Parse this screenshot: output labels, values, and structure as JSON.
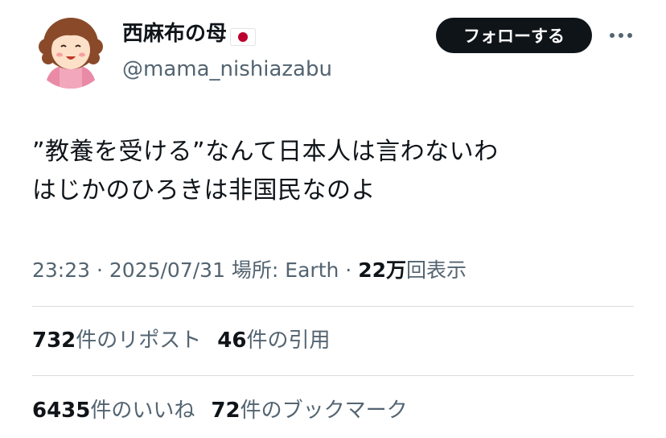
{
  "user": {
    "display_name": "西麻布の母",
    "flag_icon": "japan-flag-icon",
    "handle": "@mama_nishiazabu",
    "avatar_icon": "mother-illustration-avatar"
  },
  "follow_label": "フォローする",
  "more_icon": "more-horizontal-icon",
  "tweet": {
    "line1": "”教養を受ける”なんて日本人は言わないわ",
    "line2": "はじかのひろきは非国民なのよ"
  },
  "meta": {
    "time": "23:23",
    "sep1": " · ",
    "date": "2025/07/31",
    "location": " 場所: Earth",
    "sep2": " · ",
    "views_count": "22万",
    "views_label": "回表示"
  },
  "stats": {
    "reposts_count": "732",
    "reposts_label": "件のリポスト",
    "quotes_count": "46",
    "quotes_label": "件の引用",
    "likes_count": "6435",
    "likes_label": "件のいいね",
    "bookmarks_count": "72",
    "bookmarks_label": "件のブックマーク"
  },
  "colors": {
    "text_primary": "#0f1419",
    "text_secondary": "#536471",
    "divider": "#d9dde1",
    "button_bg": "#0f1419",
    "flag_red": "#bc002d"
  }
}
